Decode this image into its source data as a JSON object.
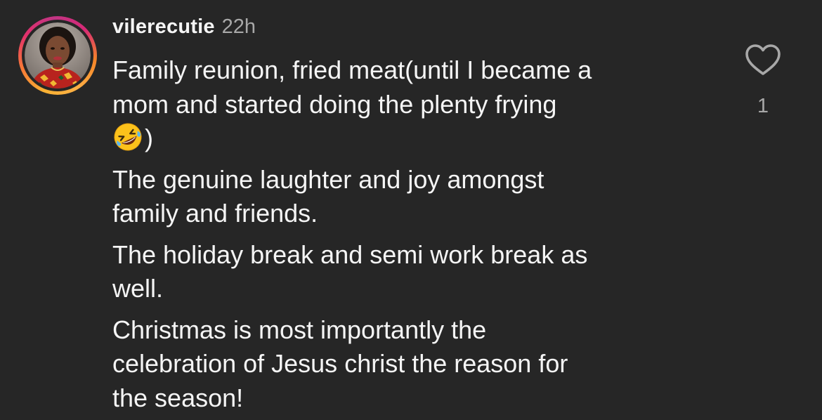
{
  "comment": {
    "username": "vilerecutie",
    "timestamp": "22h",
    "avatar_icon": "user-avatar-photo",
    "paragraphs": [
      [
        "Family reunion, fried meat(until I became a",
        "mom and started doing the plenty frying",
        ")"
      ],
      [
        "The genuine laughter and joy amongst",
        "family and friends."
      ],
      [
        "The holiday break and semi work break as",
        "well."
      ],
      [
        "Christmas is most importantly the",
        "celebration of Jesus christ the reason for",
        "the season!"
      ]
    ],
    "emoji": "rolling-on-floor-laughing-emoji",
    "like_icon": "heart-outline-icon",
    "like_count": "1"
  },
  "colors": {
    "background": "#262626",
    "text": "#f5f5f5",
    "muted": "#a8a8a8"
  }
}
